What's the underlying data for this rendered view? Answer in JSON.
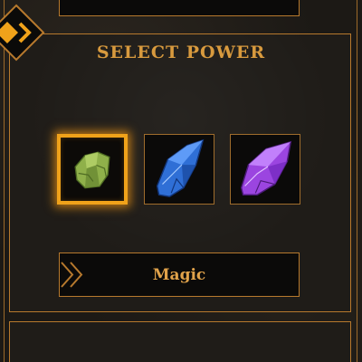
{
  "screen": {
    "title": "SELECT POWER"
  },
  "powers": [
    {
      "id": "earth",
      "icon": "green-crystal-icon",
      "color": "#8fb04a",
      "selected": true
    },
    {
      "id": "water",
      "icon": "blue-crystal-icon",
      "color": "#2f6fd6",
      "selected": false
    },
    {
      "id": "arcane",
      "icon": "purple-crystal-icon",
      "color": "#9b45e0",
      "selected": false
    }
  ],
  "selected_power": {
    "label": "Magic"
  },
  "theme": {
    "accent": "#d89a3e",
    "frame": "#b7792d",
    "selected_glow": "#f0a21a",
    "background": "#1f1c18"
  }
}
